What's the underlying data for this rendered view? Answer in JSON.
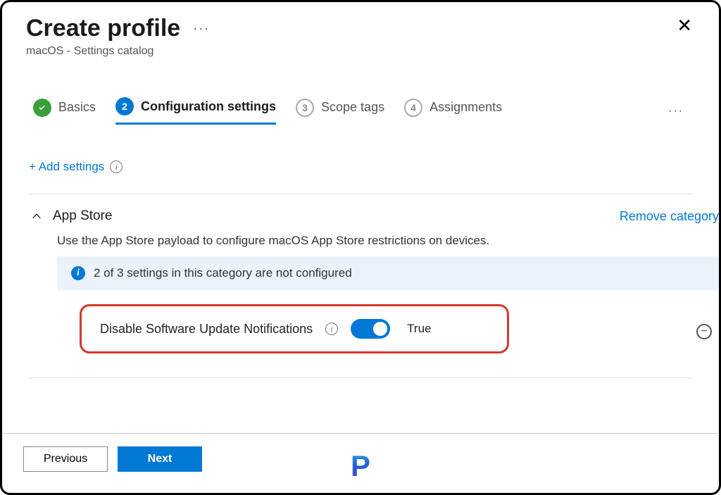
{
  "header": {
    "title": "Create profile",
    "subtitle": "macOS - Settings catalog",
    "ellipsis": "···"
  },
  "steps": [
    {
      "label": "Basics",
      "state": "complete"
    },
    {
      "label": "Configuration settings",
      "num": "2",
      "state": "active"
    },
    {
      "label": "Scope tags",
      "num": "3",
      "state": "inactive"
    },
    {
      "label": "Assignments",
      "num": "4",
      "state": "inactive"
    }
  ],
  "add_settings": {
    "label": "+ Add settings"
  },
  "category": {
    "title": "App Store",
    "remove_label": "Remove category",
    "description": "Use the App Store payload to configure macOS App Store restrictions on devices.",
    "banner": "2 of 3 settings in this category are not configured"
  },
  "setting": {
    "label": "Disable Software Update Notifications",
    "value_label": "True",
    "enabled": true
  },
  "footer": {
    "previous": "Previous",
    "next": "Next"
  },
  "brand_letter": "P"
}
